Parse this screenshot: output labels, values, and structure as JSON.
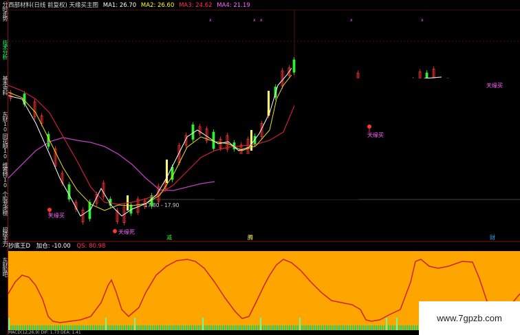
{
  "window": {
    "title": "西部材料(日线 前复权) 天缘买主图"
  },
  "main_indicators": [
    {
      "label": "MA1: 26.70",
      "color": "#ffffff"
    },
    {
      "label": "MA2: 26.60",
      "color": "#ffff33"
    },
    {
      "label": "MA3: 24.62",
      "color": "#ff3355"
    },
    {
      "label": "MA4: 21.19",
      "color": "#ff66ff"
    }
  ],
  "left_tabs": [
    {
      "label": "分时走势",
      "active": false
    },
    {
      "label": "技术分析",
      "active": true
    },
    {
      "label": "基本资料",
      "active": false
    },
    {
      "label": "东财10",
      "active": false
    },
    {
      "label": "同花顺10",
      "active": false
    },
    {
      "label": "维赛特10",
      "active": false
    },
    {
      "label": "个股龙虎榜",
      "active": false
    },
    {
      "label": "超级主力",
      "active": false
    },
    {
      "label": "东财股吧",
      "active": false
    }
  ],
  "annotations": {
    "buy_signal_1": "天缘买",
    "buy_signal_2": "天缘买",
    "buy_signal_3": "天缘买",
    "death_signal": "天缘死",
    "price_range": "17.80 - 17.90",
    "bottom_marker_1": "减",
    "bottom_marker_2": "腾",
    "bottom_marker_3": "财"
  },
  "sub_indicator": {
    "title": "抄底王D",
    "add_position": "加仓: -10.00",
    "qs": "QS: 80.98",
    "title_color": "#ffffff",
    "add_color": "#ffffff",
    "qs_color": "#ff3355"
  },
  "bottom_info": "MACD(12,26,9) DIF: 1.73 DEA: 1.41",
  "watermark": "www.7gpzb.com",
  "colors": {
    "background": "#000000",
    "up_candle": "#ff3333",
    "down_candle": "#33ee33",
    "sub_fill": "#ffa500",
    "sub_line": "#dd3333",
    "signal_bar": "#ffff66"
  }
}
